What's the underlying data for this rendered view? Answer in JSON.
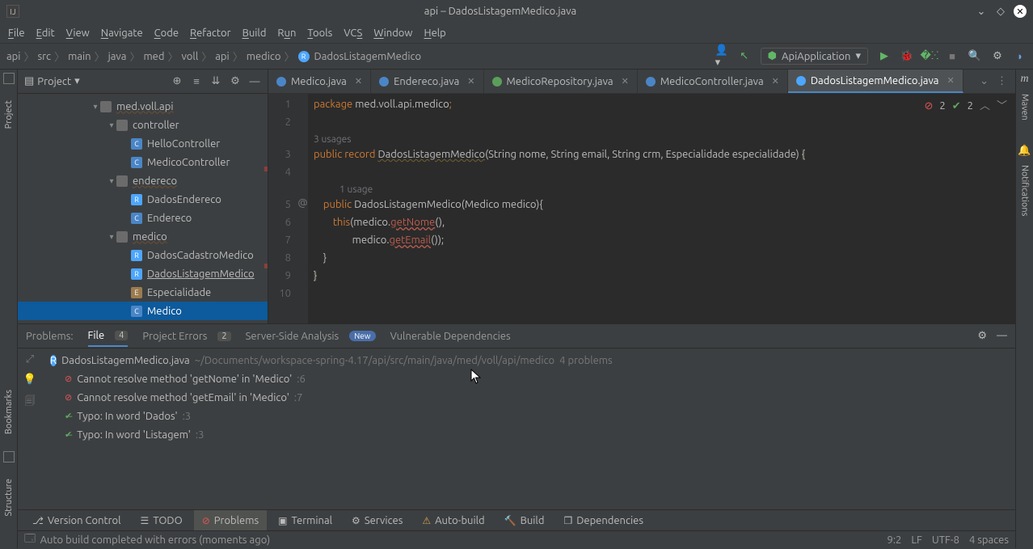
{
  "window": {
    "title": "api – DadosListagemMedico.java"
  },
  "menu": [
    "File",
    "Edit",
    "View",
    "Navigate",
    "Code",
    "Refactor",
    "Build",
    "Run",
    "Tools",
    "VCS",
    "Window",
    "Help"
  ],
  "breadcrumb": [
    "api",
    "src",
    "main",
    "java",
    "med",
    "voll",
    "api",
    "medico"
  ],
  "breadcrumb_file": "DadosListagemMedico",
  "run_config": "ApiApplication",
  "side_left": {
    "project": "Project",
    "bookmarks": "Bookmarks",
    "structure": "Structure"
  },
  "side_right": {
    "maven": "Maven",
    "notifications": "Notifications"
  },
  "project_panel": {
    "title": "Project"
  },
  "tree": {
    "pkg": "med.voll.api",
    "controller": "controller",
    "hello": "HelloController",
    "medicoctrl": "MedicoController",
    "endereco_pkg": "endereco",
    "dados_end": "DadosEndereco",
    "endereco": "Endereco",
    "medico_pkg": "medico",
    "dados_cad": "DadosCadastroMedico",
    "dados_list": "DadosListagemMedico",
    "especial": "Especialidade",
    "medico": "Medico"
  },
  "tabs": [
    {
      "icon": "c",
      "label": "Medico.java"
    },
    {
      "icon": "c",
      "label": "Endereco.java"
    },
    {
      "icon": "i",
      "label": "MedicoRepository.java"
    },
    {
      "icon": "c",
      "label": "MedicoController.java"
    },
    {
      "icon": "r",
      "label": "DadosListagemMedico.java"
    }
  ],
  "inspections": {
    "errors": "2",
    "warnings": "2"
  },
  "code": {
    "line1_pkg": "package ",
    "line1_path": "med.voll.api.medico",
    "line1_semi": ";",
    "usages3": "3 usages",
    "l3_pub": "public ",
    "l3_rec": "record ",
    "l3_name": "DadosListagemMedico",
    "l3_sig": "(String nome, String email, String crm, Especialidade especialidade) ",
    "l3_brace": "{",
    "usage1": "1 usage",
    "l5_pub": "public ",
    "l5_name": "DadosListagemMedico",
    "l5_sig": "(Medico medico){",
    "l6_this": "this",
    "l6_a": "(medico.",
    "l6_fn": "getNome",
    "l6_b": "(),",
    "l7_a": "medico.",
    "l7_fn": "getEmail",
    "l7_b": "());",
    "l8": "}",
    "l9": "}"
  },
  "gutter": [
    "1",
    "2",
    "3",
    "4",
    "5",
    "6",
    "7",
    "8",
    "9",
    "10"
  ],
  "problems_header": {
    "label": "Problems:",
    "file": "File",
    "file_cnt": "4",
    "pe": "Project Errors",
    "pe_cnt": "2",
    "ssa": "Server-Side Analysis",
    "ssa_badge": "New",
    "vd": "Vulnerable Dependencies"
  },
  "problems_file": {
    "name": "DadosListagemMedico.java",
    "path": "~/Documents/workspace-spring-4.17/api/src/main/java/med/voll/api/medico",
    "count": "4 problems"
  },
  "problems_list": [
    {
      "type": "err",
      "msg": "Cannot resolve method 'getNome' in 'Medico'",
      "loc": ":6"
    },
    {
      "type": "err",
      "msg": "Cannot resolve method 'getEmail' in 'Medico'",
      "loc": ":7"
    },
    {
      "type": "warn",
      "msg": "Typo: In word 'Dados'",
      "loc": ":3"
    },
    {
      "type": "warn",
      "msg": "Typo: In word 'Listagem'",
      "loc": ":3"
    }
  ],
  "bottom_tools": {
    "vc": "Version Control",
    "todo": "TODO",
    "problems": "Problems",
    "terminal": "Terminal",
    "services": "Services",
    "auto": "Auto-build",
    "build": "Build",
    "deps": "Dependencies"
  },
  "status": {
    "msg": "Auto build completed with errors (moments ago)",
    "pos": "9:2",
    "le": "LF",
    "enc": "UTF-8",
    "indent": "4 spaces"
  }
}
